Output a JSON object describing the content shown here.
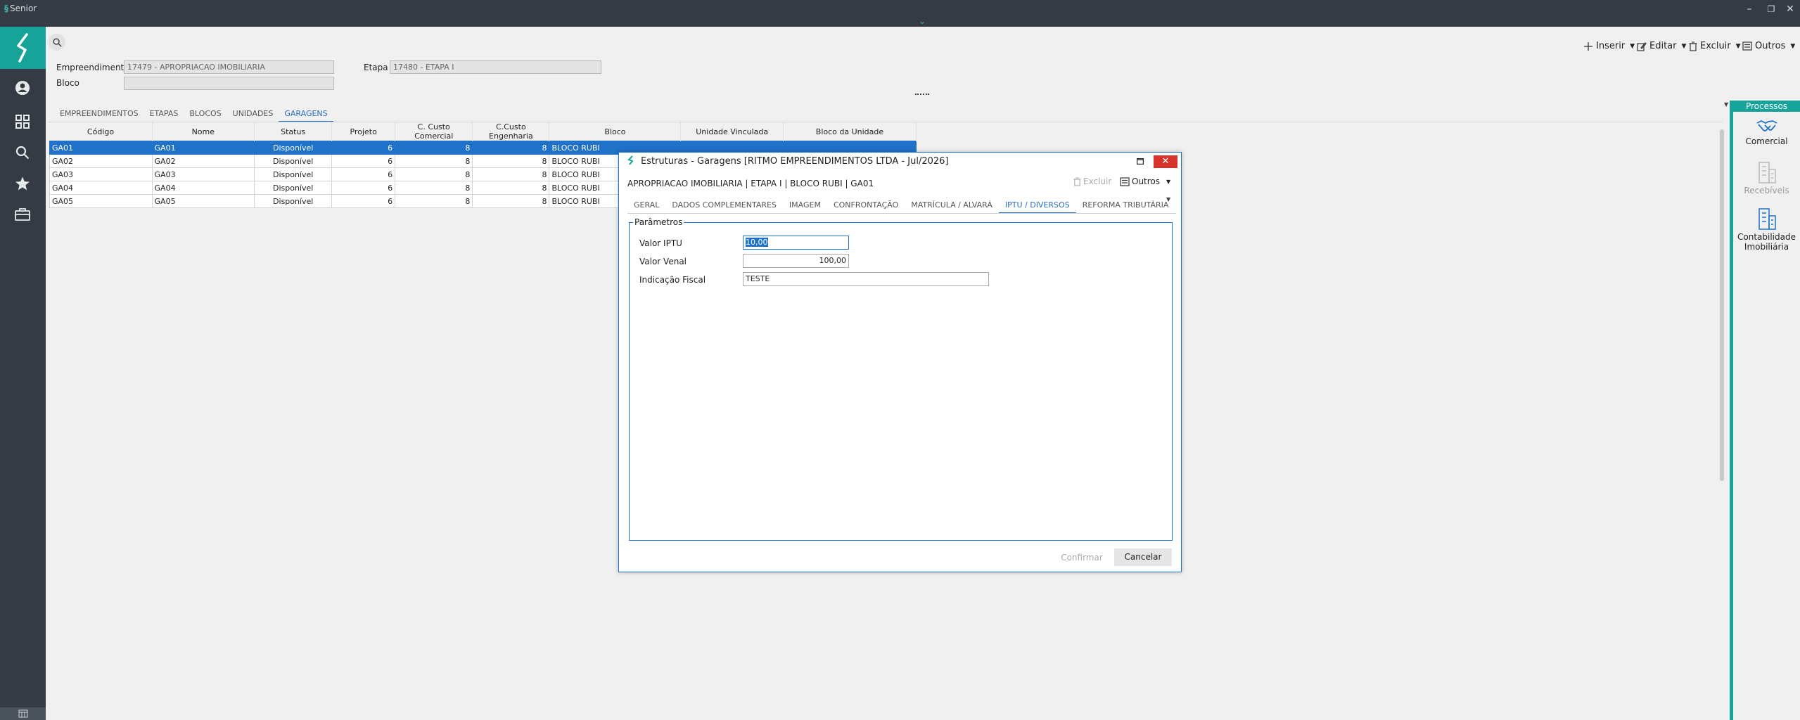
{
  "window": {
    "app_title": "Senior",
    "minimize": "–",
    "restore": "❐",
    "close": "✕"
  },
  "toolbar": {
    "insert": "Inserir",
    "edit": "Editar",
    "delete": "Excluir",
    "others": "Outros"
  },
  "filters": {
    "empreendimento_label": "Empreendimento",
    "empreendimento_value": "17479 - APROPRIACAO IMOBILIARIA",
    "etapa_label": "Etapa",
    "etapa_value": "17480 - ETAPA I",
    "bloco_label": "Bloco",
    "bloco_value": ""
  },
  "tabs": [
    {
      "label": "EMPREENDIMENTOS"
    },
    {
      "label": "ETAPAS"
    },
    {
      "label": "BLOCOS"
    },
    {
      "label": "UNIDADES"
    },
    {
      "label": "GARAGENS"
    }
  ],
  "grid": {
    "columns": [
      "Código",
      "Nome",
      "Status",
      "Projeto",
      "C. Custo Comercial",
      "C.Custo Engenharia",
      "Bloco",
      "Unidade Vinculada",
      "Bloco da Unidade"
    ],
    "rows": [
      [
        "GA01",
        "GA01",
        "Disponível",
        "6",
        "8",
        "8",
        "BLOCO RUBI",
        "",
        ""
      ],
      [
        "GA02",
        "GA02",
        "Disponível",
        "6",
        "8",
        "8",
        "BLOCO RUBI",
        "",
        ""
      ],
      [
        "GA03",
        "GA03",
        "Disponível",
        "6",
        "8",
        "8",
        "BLOCO RUBI",
        "",
        ""
      ],
      [
        "GA04",
        "GA04",
        "Disponível",
        "6",
        "8",
        "8",
        "BLOCO RUBI",
        "",
        ""
      ],
      [
        "GA05",
        "GA05",
        "Disponível",
        "6",
        "8",
        "8",
        "BLOCO RUBI",
        "",
        ""
      ]
    ]
  },
  "right_panel": {
    "header": "Processos",
    "items": [
      {
        "label": "Comercial"
      },
      {
        "label": "Recebíveis"
      },
      {
        "label": "Contabilidade Imobiliária"
      }
    ]
  },
  "dialog": {
    "title": "Estruturas - Garagens [RITMO EMPREENDIMENTOS LTDA - Jul/2026]",
    "context": "APROPRIACAO IMOBILIARIA | ETAPA I | BLOCO RUBI | GA01",
    "delete": "Excluir",
    "others": "Outros",
    "tabs": [
      {
        "label": "GERAL"
      },
      {
        "label": "DADOS COMPLEMENTARES"
      },
      {
        "label": "IMAGEM"
      },
      {
        "label": "CONFRONTAÇÃO"
      },
      {
        "label": "MATRÍCULA / ALVARÁ"
      },
      {
        "label": "IPTU / DIVERSOS"
      },
      {
        "label": "REFORMA TRIBUTÁRIA"
      }
    ],
    "group_title": "Parâmetros",
    "fields": {
      "valor_iptu_label": "Valor IPTU",
      "valor_iptu_value": "10,00",
      "valor_venal_label": "Valor Venal",
      "valor_venal_value": "100,00",
      "indicacao_fiscal_label": "Indicação Fiscal",
      "indicacao_fiscal_value": "TESTE"
    },
    "confirm": "Confirmar",
    "cancel": "Cancelar"
  }
}
